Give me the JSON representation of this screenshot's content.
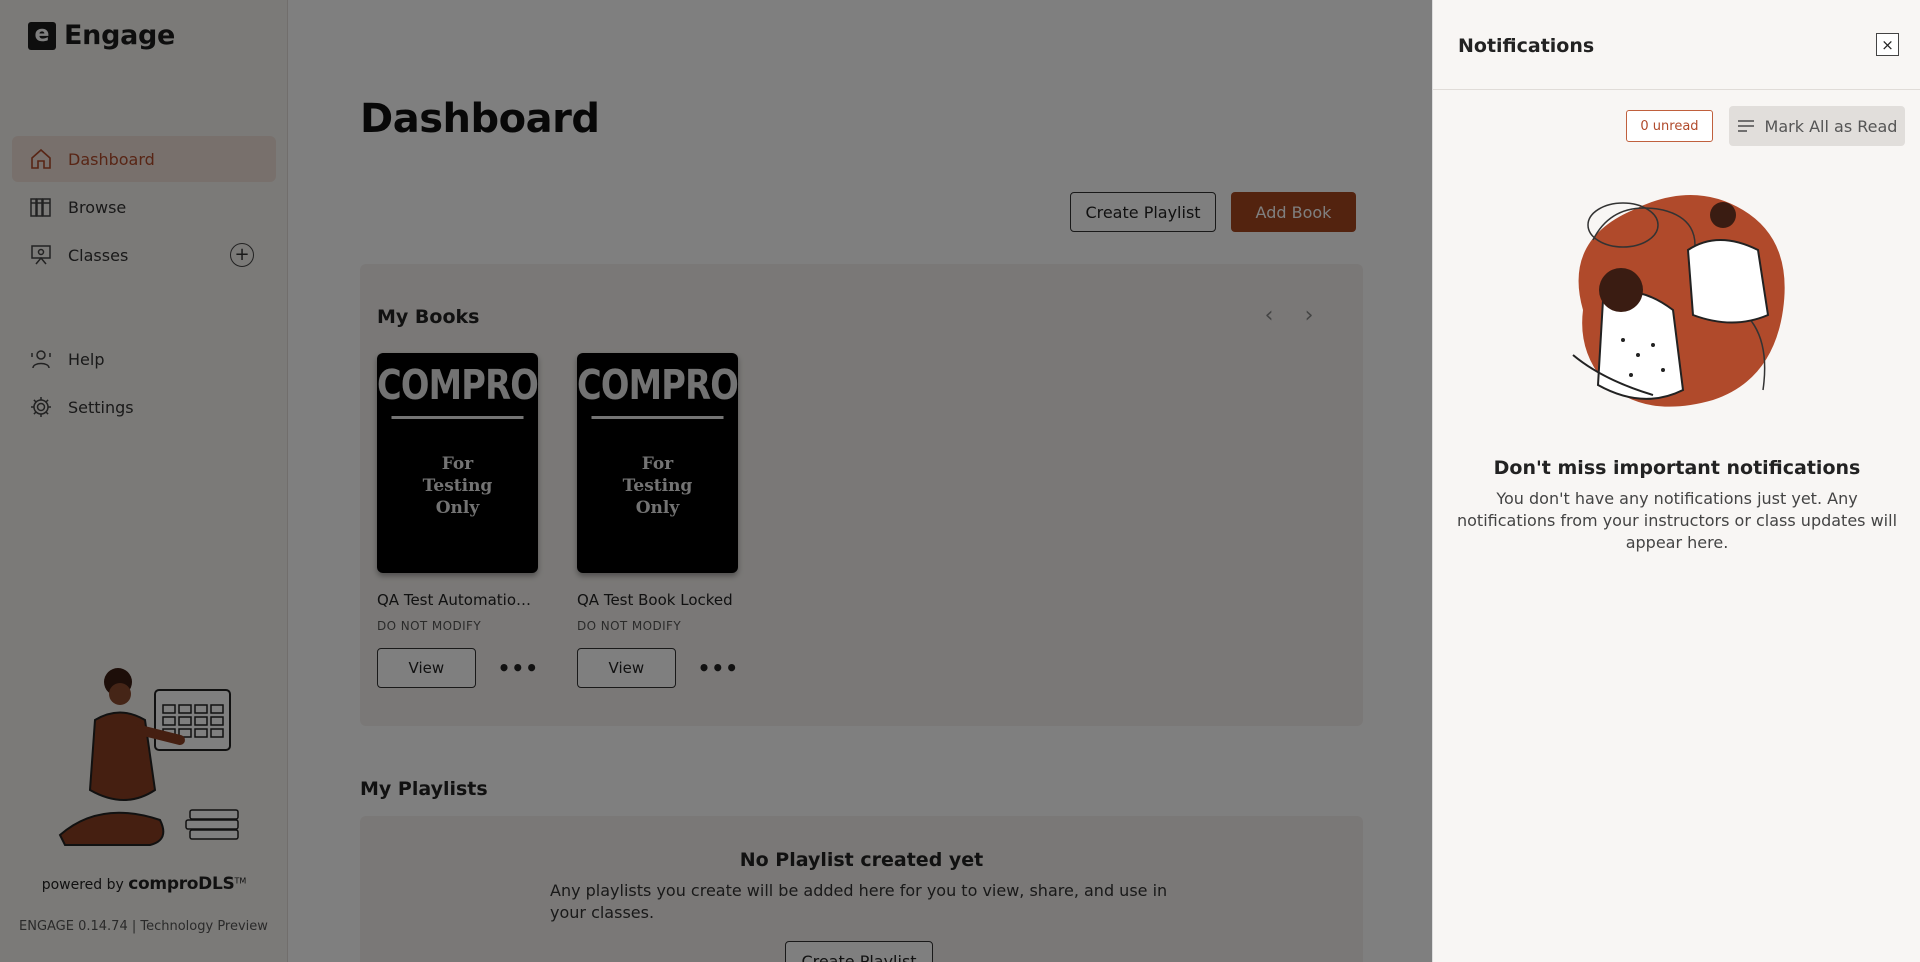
{
  "app": {
    "logo_letter": "e",
    "name": "Engage"
  },
  "sidebar": {
    "items": [
      {
        "label": "Dashboard",
        "icon": "home-icon",
        "active": true
      },
      {
        "label": "Browse",
        "icon": "library-icon",
        "active": false
      },
      {
        "label": "Classes",
        "icon": "classroom-icon",
        "active": false
      },
      {
        "label": "Help",
        "icon": "help-icon",
        "active": false
      },
      {
        "label": "Settings",
        "icon": "gear-icon",
        "active": false
      }
    ],
    "powered_by": "powered by",
    "powered_brand": "comproDLS",
    "powered_tm": "TM",
    "version": "ENGAGE 0.14.74 | Technology Preview"
  },
  "main": {
    "title": "Dashboard",
    "create_playlist_label": "Create Playlist",
    "add_book_label": "Add Book",
    "my_books": {
      "title": "My Books",
      "books": [
        {
          "cover_brand": "COMPRO",
          "cover_line1": "For",
          "cover_line2": "Testing",
          "cover_line3": "Only",
          "title": "QA Test Automation Book",
          "subtitle": "DO NOT MODIFY",
          "view_label": "View",
          "more_label": "•••"
        },
        {
          "cover_brand": "COMPRO",
          "cover_line1": "For",
          "cover_line2": "Testing",
          "cover_line3": "Only",
          "title": "QA Test Book Locked",
          "subtitle": "DO NOT MODIFY",
          "view_label": "View",
          "more_label": "•••"
        }
      ]
    },
    "my_playlists": {
      "title": "My Playlists",
      "empty_title": "No Playlist created yet",
      "empty_text": "Any playlists you create will be added here for you to view, share, and use in your classes.",
      "create_label": "Create Playlist"
    }
  },
  "notifications": {
    "title": "Notifications",
    "close_label": "×",
    "unread_badge": "0 unread",
    "mark_all_label": "Mark All as Read",
    "empty_title": "Don't miss important notifications",
    "empty_text": "You don't have any notifications just yet. Any notifications from your instructors or class updates will appear here."
  },
  "colors": {
    "accent": "#a7461f",
    "overlay": "rgba(0,0,0,0.5)",
    "drawer_bg": "#f8f6f4"
  }
}
